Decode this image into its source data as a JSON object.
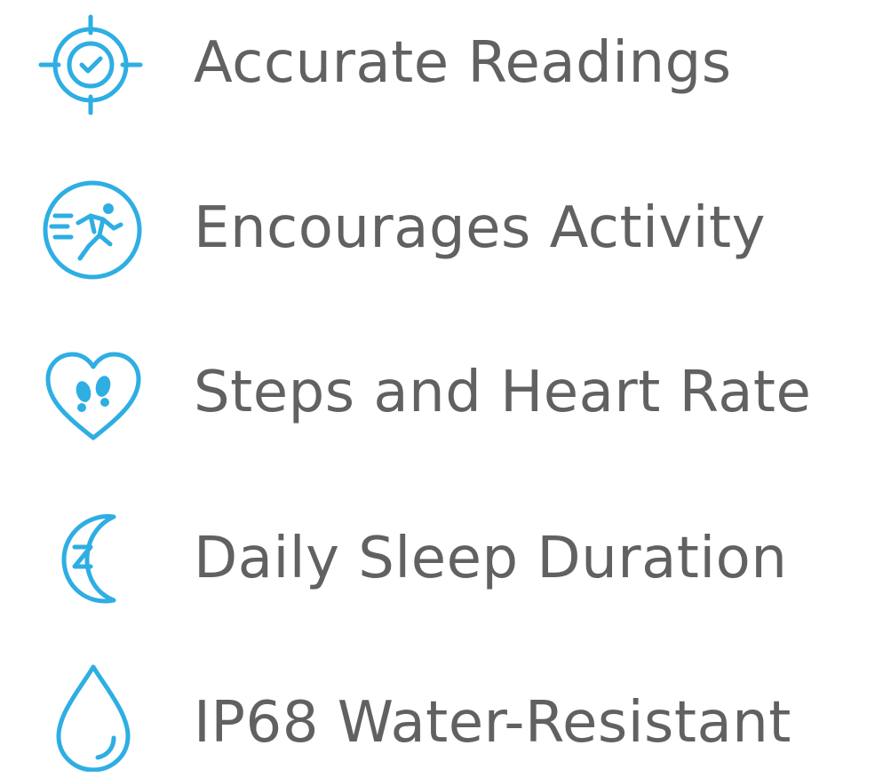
{
  "accent_color": "#2eaee3",
  "text_color": "#616161",
  "features": [
    {
      "icon": "target-check-icon",
      "label": "Accurate Readings"
    },
    {
      "icon": "running-person-icon",
      "label": "Encourages Activity"
    },
    {
      "icon": "heart-footprints-icon",
      "label": "Steps and Heart Rate"
    },
    {
      "icon": "moon-sleep-icon",
      "label": "Daily Sleep Duration"
    },
    {
      "icon": "water-drop-icon",
      "label": "IP68 Water-Resistant"
    }
  ]
}
